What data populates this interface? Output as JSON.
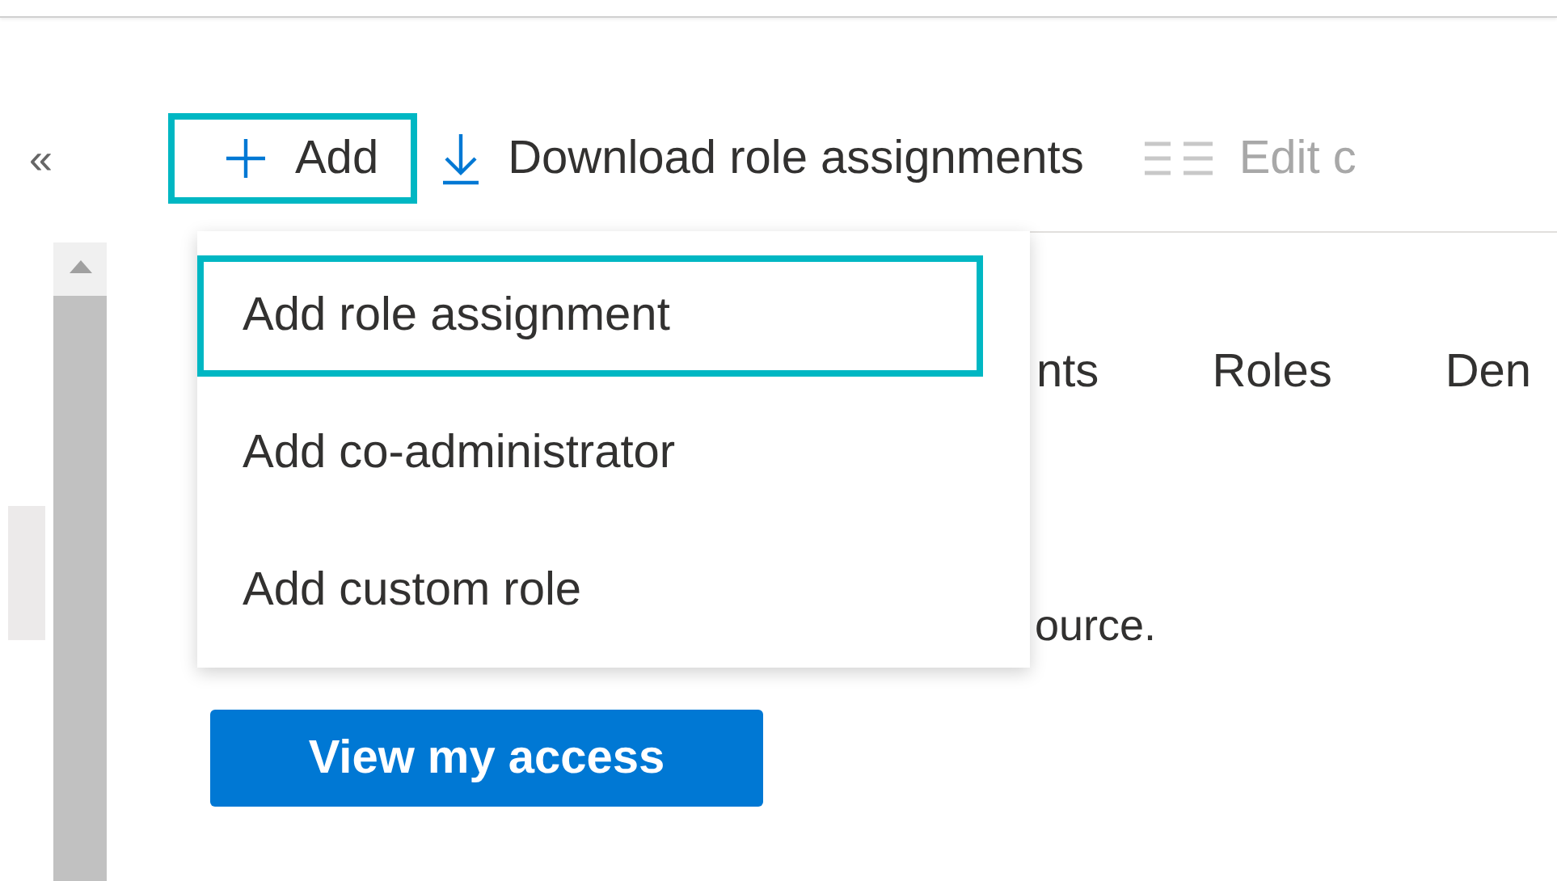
{
  "collapse_button": {
    "label": "«"
  },
  "toolbar": [
    {
      "kind": "add",
      "label": "Add",
      "highlighted": true,
      "disabled": false
    },
    {
      "kind": "download",
      "label": "Download role assignments",
      "highlighted": false,
      "disabled": false
    },
    {
      "kind": "columns",
      "label": "Edit c",
      "highlighted": false,
      "disabled": true
    }
  ],
  "tabs": [
    {
      "label": "nts"
    },
    {
      "label": "Roles"
    },
    {
      "label": "Den"
    }
  ],
  "description": "ource.",
  "primary_button": {
    "label": "View my access"
  },
  "dropdown_menu": [
    {
      "label": "Add role assignment",
      "selected": true
    },
    {
      "label": "Add co-administrator",
      "selected": false
    },
    {
      "label": "Add custom role",
      "selected": false
    }
  ]
}
